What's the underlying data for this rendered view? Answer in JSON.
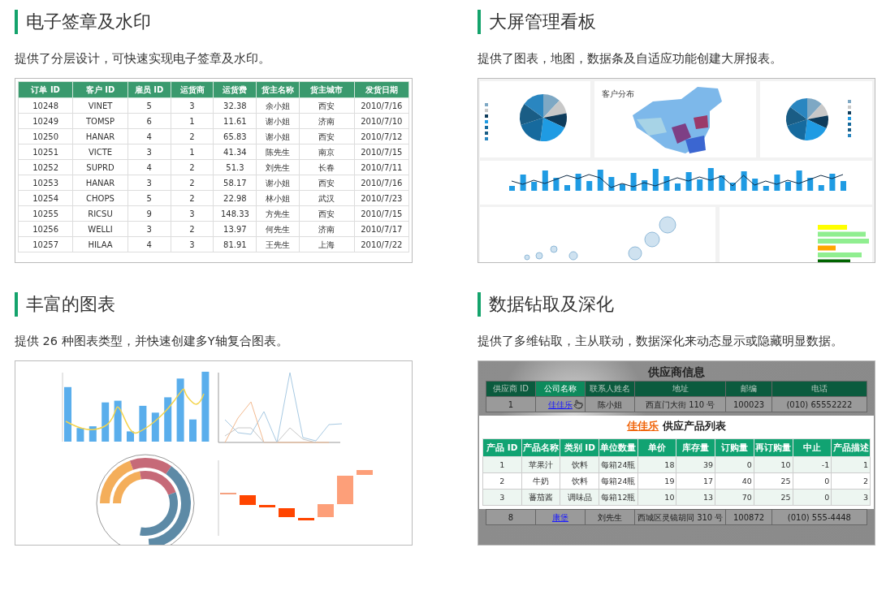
{
  "sections": [
    {
      "kind": "table",
      "title": "电子签章及水印",
      "description": "提供了分层设计，可快速实现电子签章及水印。",
      "table": {
        "columns": [
          "订单 ID",
          "客户 ID",
          "雇员 ID",
          "运货商",
          "运货费",
          "货主名称",
          "货主城市",
          "发货日期"
        ],
        "rows": [
          [
            "10248",
            "VINET",
            "5",
            "3",
            "32.38",
            "余小姐",
            "西安",
            "2010/7/16"
          ],
          [
            "10249",
            "TOMSP",
            "6",
            "1",
            "11.61",
            "谢小姐",
            "济南",
            "2010/7/10"
          ],
          [
            "10250",
            "HANAR",
            "4",
            "2",
            "65.83",
            "谢小姐",
            "西安",
            "2010/7/12"
          ],
          [
            "10251",
            "VICTE",
            "3",
            "1",
            "41.34",
            "陈先生",
            "南京",
            "2010/7/15"
          ],
          [
            "10252",
            "SUPRD",
            "4",
            "2",
            "51.3",
            "刘先生",
            "长春",
            "2010/7/11"
          ],
          [
            "10253",
            "HANAR",
            "3",
            "2",
            "58.17",
            "谢小姐",
            "西安",
            "2010/7/16"
          ],
          [
            "10254",
            "CHOPS",
            "5",
            "2",
            "22.98",
            "林小姐",
            "武汉",
            "2010/7/23"
          ],
          [
            "10255",
            "RICSU",
            "9",
            "3",
            "148.33",
            "方先生",
            "西安",
            "2010/7/15"
          ],
          [
            "10256",
            "WELLI",
            "3",
            "2",
            "13.97",
            "何先生",
            "济南",
            "2010/7/17"
          ],
          [
            "10257",
            "HILAA",
            "4",
            "3",
            "81.91",
            "王先生",
            "上海",
            "2010/7/22"
          ]
        ]
      }
    },
    {
      "kind": "dashboard",
      "title": "大屏管理看板",
      "description": "提供了图表，地图，数据条及自适应功能创建大屏报表。",
      "map_title": "客户分布"
    },
    {
      "kind": "charts",
      "title": "丰富的图表",
      "description": "提供 26 种图表类型，并快速创建多Y轴复合图表。"
    },
    {
      "kind": "drilldown",
      "title": "数据钻取及深化",
      "description": "提供了多维钻取，主从联动，数据深化来动态显示或隐藏明显数据。",
      "report": {
        "title": "供应商信息",
        "columns": [
          "供应商 ID",
          "公司名称",
          "联系人姓名",
          "地址",
          "邮编",
          "电话"
        ],
        "rows_before": [
          [
            "1",
            "佳佳乐",
            "陈小姐",
            "西直门大街 110 号",
            "100023",
            "(010) 65552222"
          ]
        ],
        "popup": {
          "highlight": "佳佳乐",
          "title": "供应产品列表",
          "columns": [
            "产品 ID",
            "产品名称",
            "类别 ID",
            "单位数量",
            "单价",
            "库存量",
            "订购量",
            "再订购量",
            "中止",
            "产品描述"
          ],
          "rows": [
            [
              "1",
              "苹果汁",
              "饮料",
              "每箱24瓶",
              "18",
              "39",
              "0",
              "10",
              "-1",
              "1"
            ],
            [
              "2",
              "牛奶",
              "饮料",
              "每箱24瓶",
              "19",
              "17",
              "40",
              "25",
              "0",
              "2"
            ],
            [
              "3",
              "蕃茄酱",
              "调味品",
              "每箱12瓶",
              "10",
              "13",
              "70",
              "25",
              "0",
              "3"
            ]
          ]
        },
        "rows_after": [
          [
            "8",
            "康堡",
            "刘先生",
            "西城区灵镜胡同 310 号",
            "100872",
            "(010) 555-4448"
          ]
        ]
      }
    }
  ]
}
